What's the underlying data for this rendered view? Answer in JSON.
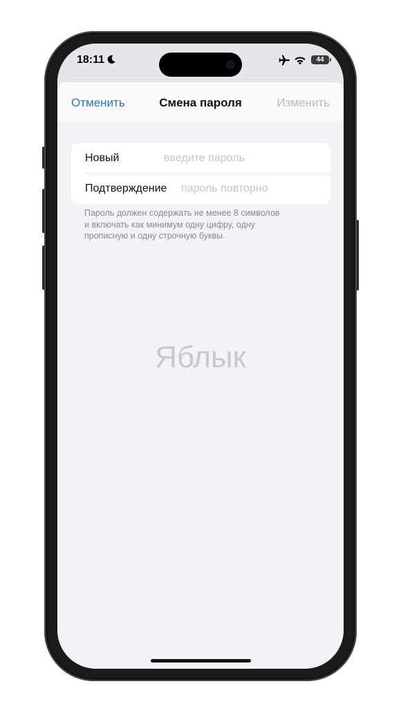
{
  "status_bar": {
    "time": "18:11",
    "battery": "44",
    "icons": [
      "moon-icon",
      "airplane-icon",
      "wifi-icon",
      "battery-icon"
    ]
  },
  "navbar": {
    "cancel_label": "Отменить",
    "title": "Смена пароля",
    "change_label": "Изменить"
  },
  "form": {
    "new": {
      "label": "Новый",
      "placeholder": "введите пароль",
      "value": ""
    },
    "confirm": {
      "label": "Подтверждение",
      "placeholder": "пароль повторно",
      "value": ""
    }
  },
  "hint": {
    "line1": "Пароль должен содержать не менее 8 символов",
    "line2": "и включать как минимум одну цифру, одну",
    "line3": "прописную и одну строчную буквы."
  },
  "watermark": "Яблык",
  "colors": {
    "accent": "#2a78b5",
    "disabled": "#b9b9bf",
    "background": "#f2f2f7"
  }
}
